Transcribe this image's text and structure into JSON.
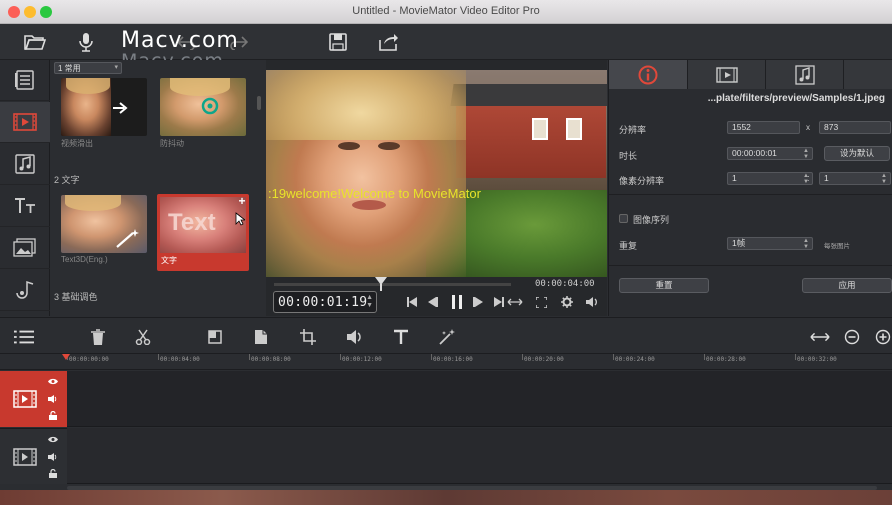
{
  "window": {
    "title": "Untitled - MovieMator Video Editor Pro"
  },
  "watermark": {
    "text": "Macv.com",
    "reflection": "Macv.com"
  },
  "toolbar": {
    "icons": [
      "open-folder-icon",
      "microphone-icon",
      "undo-icon",
      "redo-icon",
      "save-icon",
      "export-icon"
    ]
  },
  "rail": {
    "icons": [
      "media-icon",
      "filters-icon",
      "audio-icon",
      "text-icon",
      "picture-icon",
      "music-effects-icon"
    ]
  },
  "library": {
    "dropdown": "1 常用",
    "items_row1": [
      {
        "label": "视频滑出"
      },
      {
        "label": "防抖动"
      }
    ],
    "section2": "2 文字",
    "items_row2": [
      {
        "label": "Text3D(Eng.)"
      },
      {
        "label": "文字",
        "thumb_text": "Text"
      }
    ],
    "section3": "3 基础调色"
  },
  "preview": {
    "overlay_text": ":19welcome!Welcome to MovieMator",
    "duration": "00:00:04:00",
    "timecode": "00:00:01:19"
  },
  "props": {
    "path": "...plate/filters/preview/Samples/1.jpeg",
    "resolution_label": "分辨率",
    "width": "1552",
    "x_sep": "x",
    "height": "873",
    "duration_label": "时长",
    "duration": "00:00:00:01",
    "set_default": "设为默认",
    "pixel_ratio_label": "像素分辨率",
    "pixel_num": "1",
    "colon": ":",
    "pixel_den": "1",
    "sequence_label": "图像序列",
    "repeat_label": "重复",
    "repeat_value": "1帧",
    "per_image": "每张图片",
    "reset_button": "重置",
    "apply_button": "应用"
  },
  "ruler": {
    "ticks": [
      "00:00:00:00",
      "00:00:04:00",
      "00:00:08:00",
      "00:00:12:00",
      "00:00:16:00",
      "00:00:20:00",
      "00:00:24:00",
      "00:00:28:00",
      "00:00:32:00"
    ]
  },
  "colors": {
    "accent": "#c8392e",
    "close": "#fc5f57",
    "minimize": "#fdbc2e",
    "zoom": "#2ac840"
  }
}
